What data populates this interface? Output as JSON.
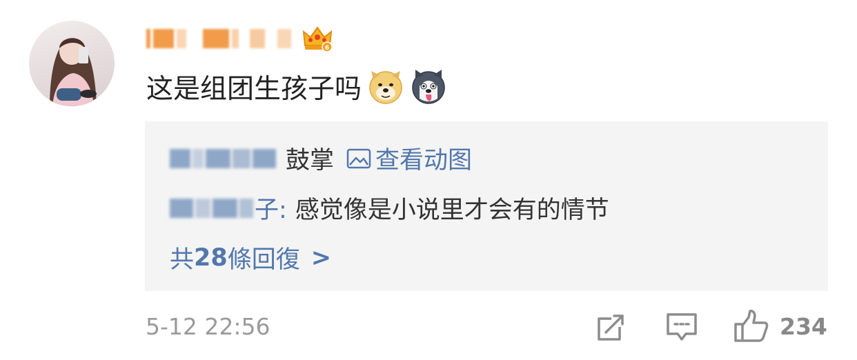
{
  "comment": {
    "avatar_icon": "avatar",
    "badge_icon": "crown-icon",
    "text": "这是组团生孩子吗",
    "emojis": [
      "doge-emoji",
      "husky-emoji"
    ]
  },
  "reply_box": {
    "line1": {
      "action": "鼓掌",
      "view_gif_label": "查看动图",
      "icon": "image-icon"
    },
    "line2": {
      "name_suffix": "子:",
      "content": "感觉像是小说里才会有的情节"
    },
    "more": {
      "prefix": "共",
      "count": "28",
      "suffix": "條回復",
      "arrow": ">"
    }
  },
  "footer": {
    "timestamp": "5-12 22:56",
    "like_count": "234",
    "icons": [
      "share-icon",
      "comment-icon",
      "like-icon"
    ]
  },
  "colors": {
    "link_blue": "#5277ac",
    "text_dark": "#222222",
    "meta_gray": "#9a9a9a",
    "reply_bg": "#f4f4f4",
    "username_orange": "#f08a2a"
  }
}
